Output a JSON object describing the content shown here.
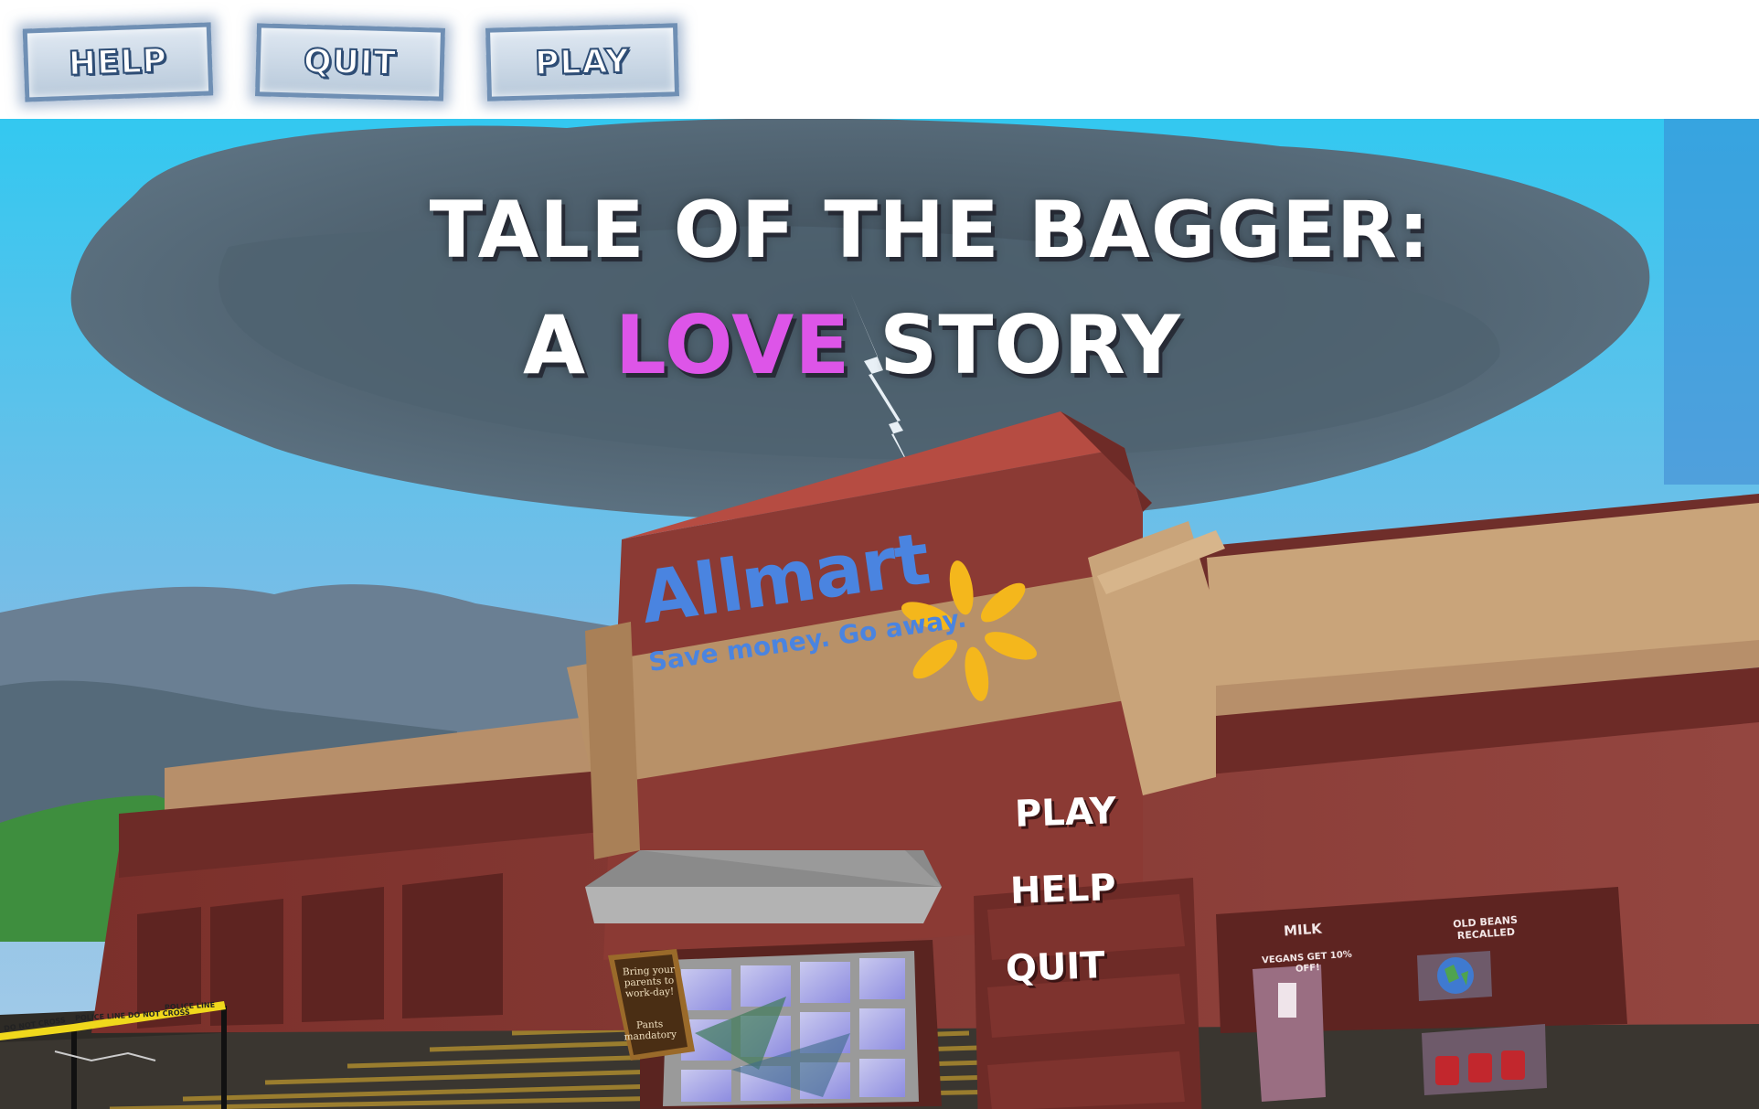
{
  "toolbar": {
    "help_label": "HELP",
    "quit_label": "QUIT",
    "play_label": "PLAY"
  },
  "title": {
    "line1": "TALE OF THE BAGGER:",
    "line2_pre": "A ",
    "line2_love": "LOVE",
    "line2_post": " STORY"
  },
  "store": {
    "name": "Allmart",
    "tagline": "Save money. Go away."
  },
  "menu": {
    "play": "PLAY",
    "help": "HELP",
    "quit": "QUIT"
  },
  "posters": {
    "milk_label": "MILK",
    "milk_sub": "VEGANS GET 10% OFF!",
    "beans_label": "OLD BEANS RECALLED"
  },
  "sandwich_sign": {
    "line1": "Bring your parents to work-day!",
    "line2": "Pants mandatory"
  },
  "tape": {
    "text1": "DO NOT CROSS",
    "text2": "POLICE LINE DO NOT CROSS",
    "text3": "POLICE LINE"
  },
  "colors": {
    "sky_top": "#33c8f0",
    "storm_cloud": "#4a5a66",
    "brick": "#8b3a34",
    "trim": "#c9a47a",
    "logo_blue": "#4a84e0",
    "logo_spark": "#f4b71c",
    "love_purple": "#dd55e8",
    "button_border": "#6f8fb4"
  },
  "icons": {
    "spark": "walmart-spark-icon",
    "lightning": "lightning-icon",
    "globe": "globe-poster-icon"
  }
}
